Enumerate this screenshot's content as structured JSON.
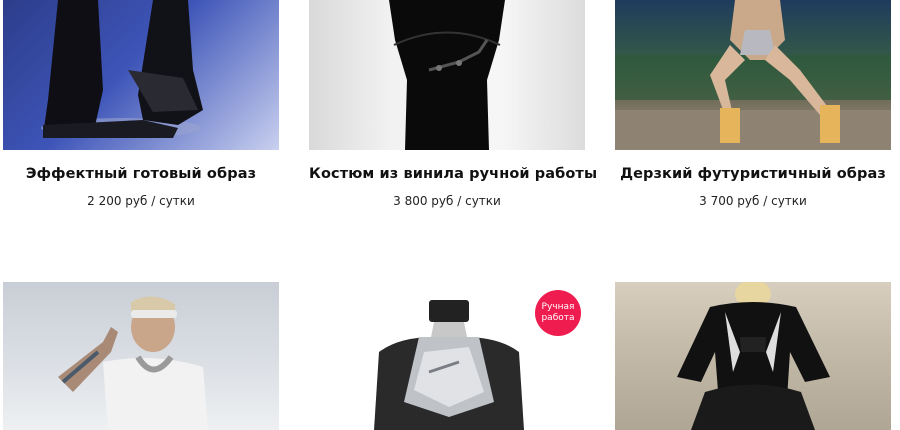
{
  "products": [
    {
      "title": "Эффектный готовый образ",
      "price": "2 200 руб / сутки",
      "image": "model-in-black-latex-kneeling"
    },
    {
      "title": "Костюм из винила ручной работы",
      "price": "3 800 руб / сутки",
      "image": "black-vinyl-bodysuit-on-mannequin"
    },
    {
      "title": "Дерзкий футуристичный образ",
      "price": "3 700 руб / сутки",
      "image": "model-in-silver-platform-heels-outdoors"
    },
    {
      "title": "",
      "price": "",
      "image": "model-with-sunglasses-and-tattoos"
    },
    {
      "title": "",
      "price": "",
      "image": "chrome-halter-top-on-mannequin",
      "badge": "Ручная работа"
    },
    {
      "title": "",
      "price": "",
      "image": "model-in-embellished-black-jacket"
    }
  ],
  "colors": {
    "badge": "#ef1c4f",
    "text": "#111111"
  }
}
